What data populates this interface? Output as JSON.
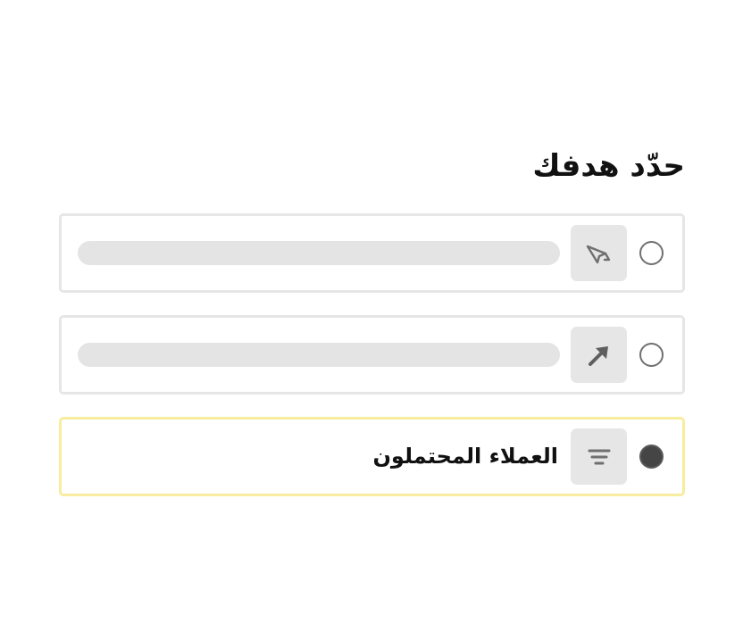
{
  "goal_picker": {
    "title": "حدّد هدفك",
    "options": [
      {
        "icon": "megaphone-icon",
        "label": "",
        "selected": false
      },
      {
        "icon": "arrow-cursor-icon",
        "label": "",
        "selected": false
      },
      {
        "icon": "filter-icon",
        "label": "العملاء المحتملون",
        "selected": true
      }
    ]
  },
  "colors": {
    "selected_border": "#f8ec9f",
    "default_border": "#e6e6e6",
    "icon_background": "#e6e6e6",
    "radio_checked_fill": "#454545"
  }
}
